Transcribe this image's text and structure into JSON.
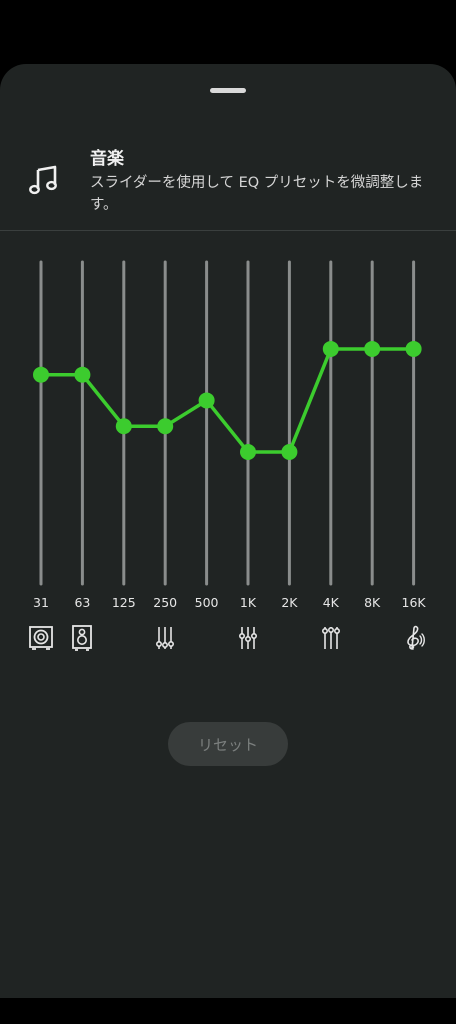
{
  "sheet": {
    "title": "音楽",
    "description": "スライダーを使用して EQ プリセットを微調整します。",
    "icon": "music-note-icon"
  },
  "equalizer": {
    "accent_color": "#3ccc2e",
    "track_color": "#8a8d8c",
    "bands": [
      {
        "label": "31",
        "level": 0.65
      },
      {
        "label": "63",
        "level": 0.65
      },
      {
        "label": "125",
        "level": 0.49
      },
      {
        "label": "250",
        "level": 0.49
      },
      {
        "label": "500",
        "level": 0.57
      },
      {
        "label": "1K",
        "level": 0.41
      },
      {
        "label": "2K",
        "level": 0.41
      },
      {
        "label": "4K",
        "level": 0.73
      },
      {
        "label": "8K",
        "level": 0.73
      },
      {
        "label": "16K",
        "level": 0.73
      }
    ],
    "band_icons": [
      {
        "name": "subwoofer-icon",
        "band": 0
      },
      {
        "name": "speaker-icon",
        "band": 1
      },
      {
        "name": "equalizer-low-icon",
        "band": 3
      },
      {
        "name": "equalizer-mid-icon",
        "band": 5
      },
      {
        "name": "equalizer-high-icon",
        "band": 7
      },
      {
        "name": "treble-clef-icon",
        "band": 9
      }
    ]
  },
  "reset_button": {
    "label": "リセット"
  }
}
